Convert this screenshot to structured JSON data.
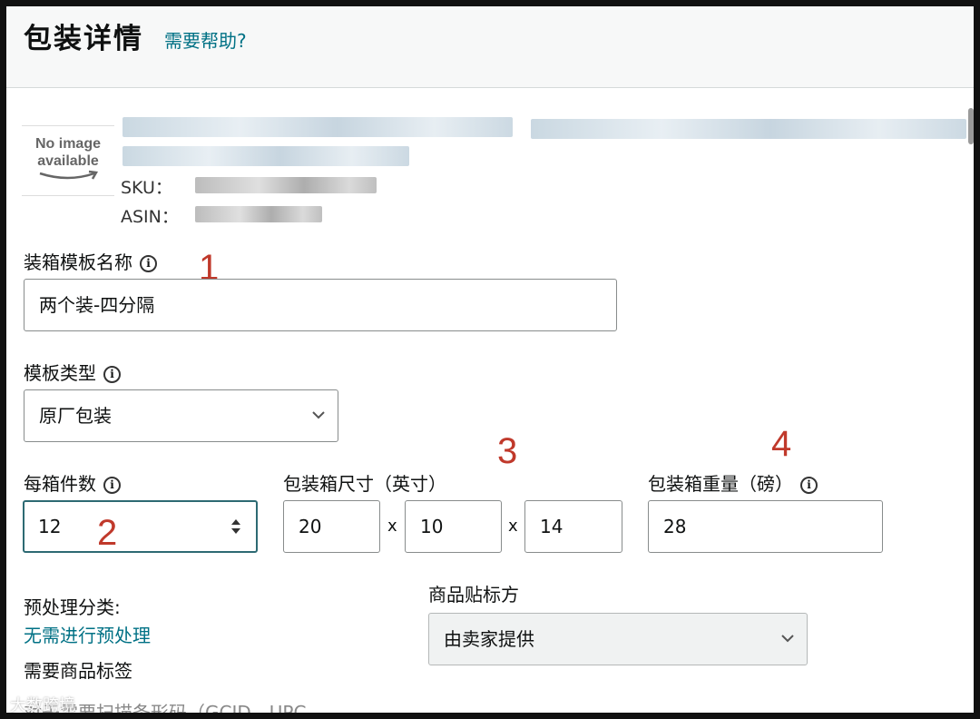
{
  "header": {
    "title": "包装详情",
    "help_link": "需要帮助?"
  },
  "product": {
    "image_placeholder": {
      "line1": "No image",
      "line2": "available"
    },
    "sku_label": "SKU：",
    "asin_label": "ASIN："
  },
  "form": {
    "template_name": {
      "label": "装箱模板名称",
      "value": "两个装-四分隔"
    },
    "template_type": {
      "label": "模板类型",
      "selected": "原厂包装"
    },
    "units_per_box": {
      "label": "每箱件数",
      "value": "12"
    },
    "box_dimensions": {
      "label": "包装箱尺寸（英寸）",
      "length": "20",
      "width": "10",
      "height": "14",
      "separator": "x"
    },
    "box_weight": {
      "label": "包装箱重量（磅）",
      "value": "28"
    },
    "prep_category": {
      "label": "预处理分类:",
      "value": "无需进行预处理"
    },
    "label_required": "需要商品标签",
    "labeler": {
      "label": "商品贴标方",
      "selected": "由卖家提供"
    },
    "cutoff_line": "对于需要扫描条形码（GCID、UPC"
  },
  "annotations": {
    "a1": "1",
    "a2": "2",
    "a3": "3",
    "a4": "4"
  },
  "watermark": "大数跨境",
  "colors": {
    "link": "#007185",
    "annotation": "#c0392b",
    "focus_border": "#2d6a73"
  }
}
